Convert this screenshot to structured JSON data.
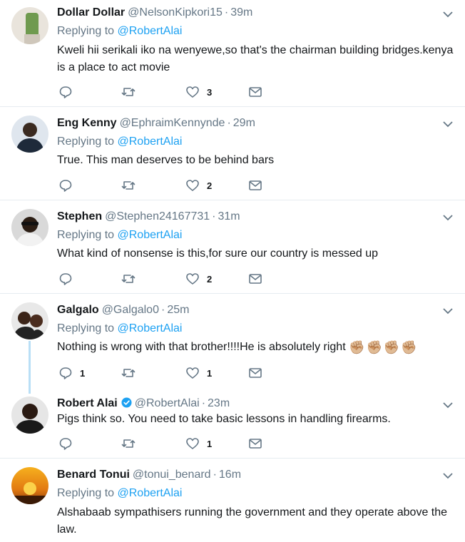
{
  "tweets": [
    {
      "name": "Dollar Dollar",
      "handle": "@NelsonKipkori15",
      "time": "39m",
      "replying_prefix": "Replying to ",
      "replying_to": "@RobertAlai",
      "text": "Kweli hii serikali iko na wenyewe,so that's the chairman building bridges.kenya is a place to act movie",
      "replies": "",
      "retweets": "",
      "likes": "3"
    },
    {
      "name": "Eng Kenny",
      "handle": "@EphraimKennynde",
      "time": "29m",
      "replying_prefix": "Replying to ",
      "replying_to": "@RobertAlai",
      "text": "True. This man deserves to be behind bars",
      "replies": "",
      "retweets": "",
      "likes": "2"
    },
    {
      "name": "Stephen",
      "handle": "@Stephen24167731",
      "time": "31m",
      "replying_prefix": "Replying to ",
      "replying_to": "@RobertAlai",
      "text": "What kind of nonsense is this,for sure our country is messed up",
      "replies": "",
      "retweets": "",
      "likes": "2"
    },
    {
      "name": "Galgalo",
      "handle": "@Galgalo0",
      "time": "25m",
      "replying_prefix": "Replying to ",
      "replying_to": "@RobertAlai",
      "text": "Nothing is wrong with that brother!!!!He is absolutely right",
      "emoji": "✊🏼✊🏼✊🏼✊🏼",
      "replies": "1",
      "retweets": "",
      "likes": "1"
    },
    {
      "name": "Robert Alai",
      "handle": "@RobertAlai",
      "time": "23m",
      "text": "Pigs think so. You need to take basic lessons in handling firearms.",
      "replies": "",
      "retweets": "",
      "likes": "1"
    },
    {
      "name": "Benard Tonui",
      "handle": "@tonui_benard",
      "time": "16m",
      "replying_prefix": "Replying to ",
      "replying_to": "@RobertAlai",
      "text": "Alshabaab sympathisers running the government and they operate above the law."
    }
  ],
  "separator": "·",
  "colors": {
    "accent": "#1da1f2",
    "secondary_text": "#657786",
    "divider": "#e6ecf0"
  }
}
